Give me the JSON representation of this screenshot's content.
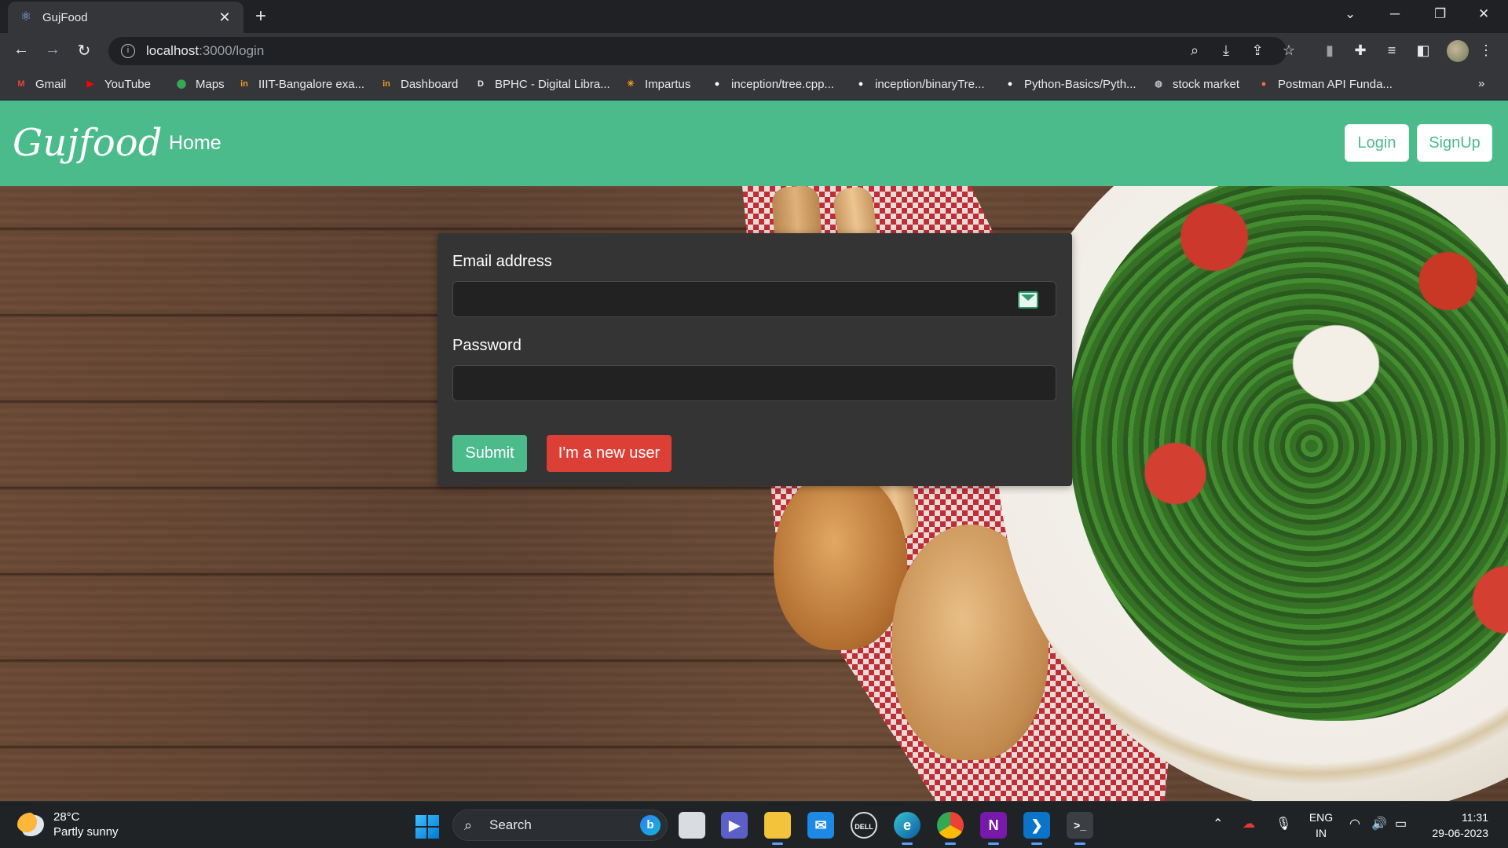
{
  "browser": {
    "tab_title": "GujFood",
    "tab_icon": "react-icon",
    "url_host": "localhost",
    "url_path": ":3000/login",
    "bookmarks": [
      {
        "label": "Gmail",
        "icon": "gmail-icon",
        "color": "#ea4335",
        "glyph": "M"
      },
      {
        "label": "YouTube",
        "icon": "youtube-icon",
        "color": "#ff0000",
        "glyph": "▶"
      },
      {
        "label": "Maps",
        "icon": "maps-icon",
        "color": "#34a853",
        "glyph": "⬤"
      },
      {
        "label": "IIIT-Bangalore exa...",
        "icon": "impartus-icon",
        "color": "#f29b1d",
        "glyph": "in"
      },
      {
        "label": "Dashboard",
        "icon": "impartus-icon",
        "color": "#f29b1d",
        "glyph": "in"
      },
      {
        "label": "BPHC - Digital Libra...",
        "icon": "library-icon",
        "color": "#e8eaed",
        "glyph": "D"
      },
      {
        "label": "Impartus",
        "icon": "impartus-star-icon",
        "color": "#f29b1d",
        "glyph": "✳"
      },
      {
        "label": "inception/tree.cpp...",
        "icon": "github-icon",
        "color": "#ffffff",
        "glyph": "●"
      },
      {
        "label": "inception/binaryTre...",
        "icon": "github-icon",
        "color": "#ffffff",
        "glyph": "●"
      },
      {
        "label": "Python-Basics/Pyth...",
        "icon": "github-icon",
        "color": "#ffffff",
        "glyph": "●"
      },
      {
        "label": "stock market",
        "icon": "globe-icon",
        "color": "#bdc1c6",
        "glyph": "◍"
      },
      {
        "label": "Postman API Funda...",
        "icon": "postman-icon",
        "color": "#ff6c37",
        "glyph": "●"
      }
    ],
    "more_bookmarks": "»"
  },
  "app": {
    "brand": "Gujfood",
    "nav_home": "Home",
    "login_label": "Login",
    "signup_label": "SignUp",
    "accent_color": "#4cbb8b"
  },
  "form": {
    "email_label": "Email address",
    "email_value": "",
    "password_label": "Password",
    "password_value": "",
    "submit_label": "Submit",
    "new_user_label": "I'm a new user",
    "submit_color": "#4cbb8b",
    "new_user_color": "#dc3f36"
  },
  "taskbar": {
    "temperature": "28°C",
    "weather": "Partly sunny",
    "search_label": "Search",
    "lang_top": "ENG",
    "lang_bottom": "IN",
    "time": "11:31",
    "date": "29-06-2023"
  }
}
